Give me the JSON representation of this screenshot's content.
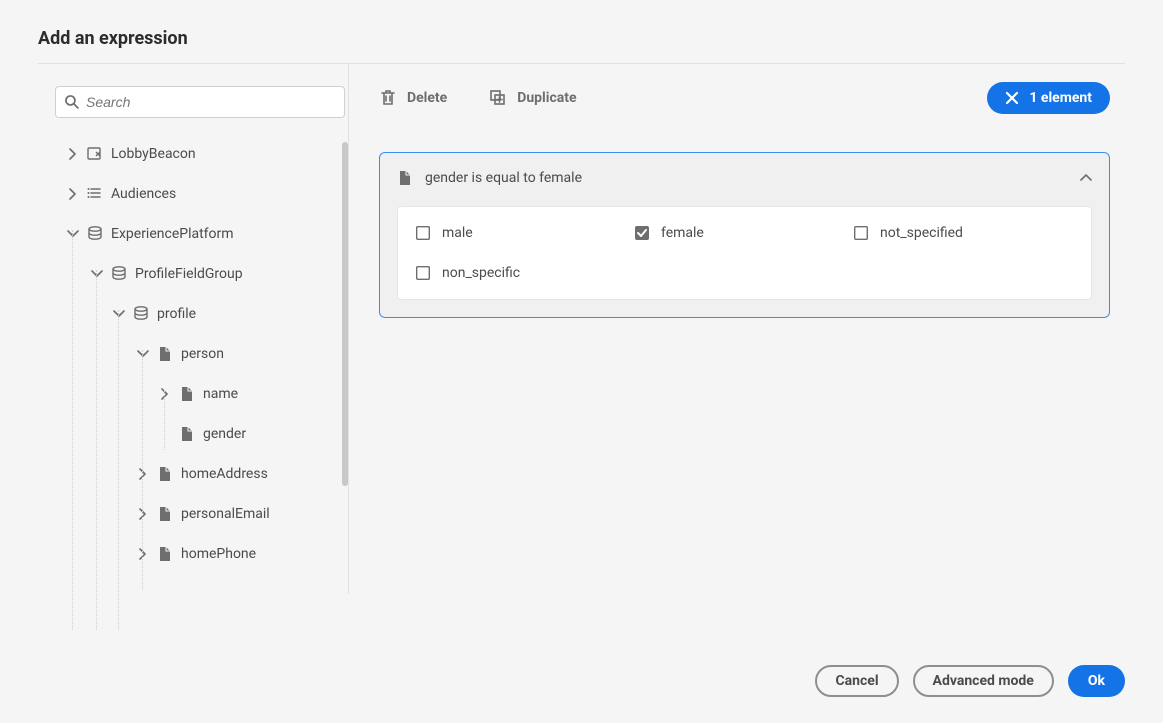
{
  "title": "Add an expression",
  "search": {
    "placeholder": "Search"
  },
  "tree": {
    "items": [
      {
        "id": "lobbybeacon",
        "label": "LobbyBeacon",
        "expanded": false,
        "icon": "event",
        "indent": 1
      },
      {
        "id": "audiences",
        "label": "Audiences",
        "expanded": false,
        "icon": "list",
        "indent": 1
      },
      {
        "id": "experienceplatform",
        "label": "ExperiencePlatform",
        "expanded": true,
        "icon": "db",
        "indent": 1
      },
      {
        "id": "profilefieldgroup",
        "label": "ProfileFieldGroup",
        "expanded": true,
        "icon": "db",
        "indent": 2
      },
      {
        "id": "profile",
        "label": "profile",
        "expanded": true,
        "icon": "db",
        "indent": 3
      },
      {
        "id": "person",
        "label": "person",
        "expanded": true,
        "icon": "file",
        "indent": 4
      },
      {
        "id": "name",
        "label": "name",
        "expanded": false,
        "icon": "file",
        "indent": 5
      },
      {
        "id": "gender",
        "label": "gender",
        "expanded": null,
        "icon": "file",
        "indent": 5
      },
      {
        "id": "homeaddress",
        "label": "homeAddress",
        "expanded": false,
        "icon": "file",
        "indent": 4
      },
      {
        "id": "personalemail",
        "label": "personalEmail",
        "expanded": false,
        "icon": "file",
        "indent": 4
      },
      {
        "id": "homephone",
        "label": "homePhone",
        "expanded": false,
        "icon": "file",
        "indent": 4
      }
    ]
  },
  "toolbar": {
    "delete": "Delete",
    "duplicate": "Duplicate",
    "element_count": "1 element"
  },
  "expression": {
    "summary": "gender is equal to female",
    "options": [
      {
        "value": "male",
        "checked": false
      },
      {
        "value": "female",
        "checked": true
      },
      {
        "value": "not_specified",
        "checked": false
      },
      {
        "value": "non_specific",
        "checked": false
      }
    ]
  },
  "footer": {
    "cancel": "Cancel",
    "advanced": "Advanced mode",
    "ok": "Ok"
  }
}
